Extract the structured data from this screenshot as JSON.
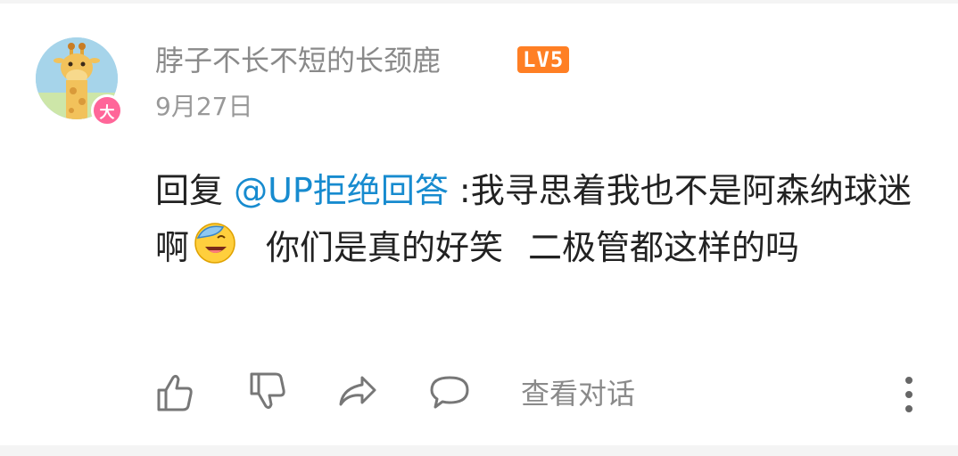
{
  "comment": {
    "username": "脖子不长不短的长颈鹿",
    "level_badge": "LV5",
    "vip_badge": "大",
    "date": "9月27日",
    "content": {
      "reply_prefix": "回复 ",
      "mention": "@UP拒绝回答",
      "text_before_emoji": " :我寻思着我也不是阿森纳球迷啊",
      "emoji": "laughing-covering-face-emoji",
      "text_after_emoji_1": "你们是真的好笑",
      "text_after_emoji_2": "二极管都这样的吗"
    },
    "actions": {
      "view_replies_label": "查看对话",
      "icons": [
        "thumbs-up-icon",
        "thumbs-down-icon",
        "share-icon",
        "reply-icon",
        "more-icon"
      ]
    }
  },
  "colors": {
    "mention": "#178bcf",
    "level_badge": "#ff7f24",
    "vip_badge": "#ff6699",
    "text": "#222222",
    "meta_text": "#8a8a8a"
  }
}
